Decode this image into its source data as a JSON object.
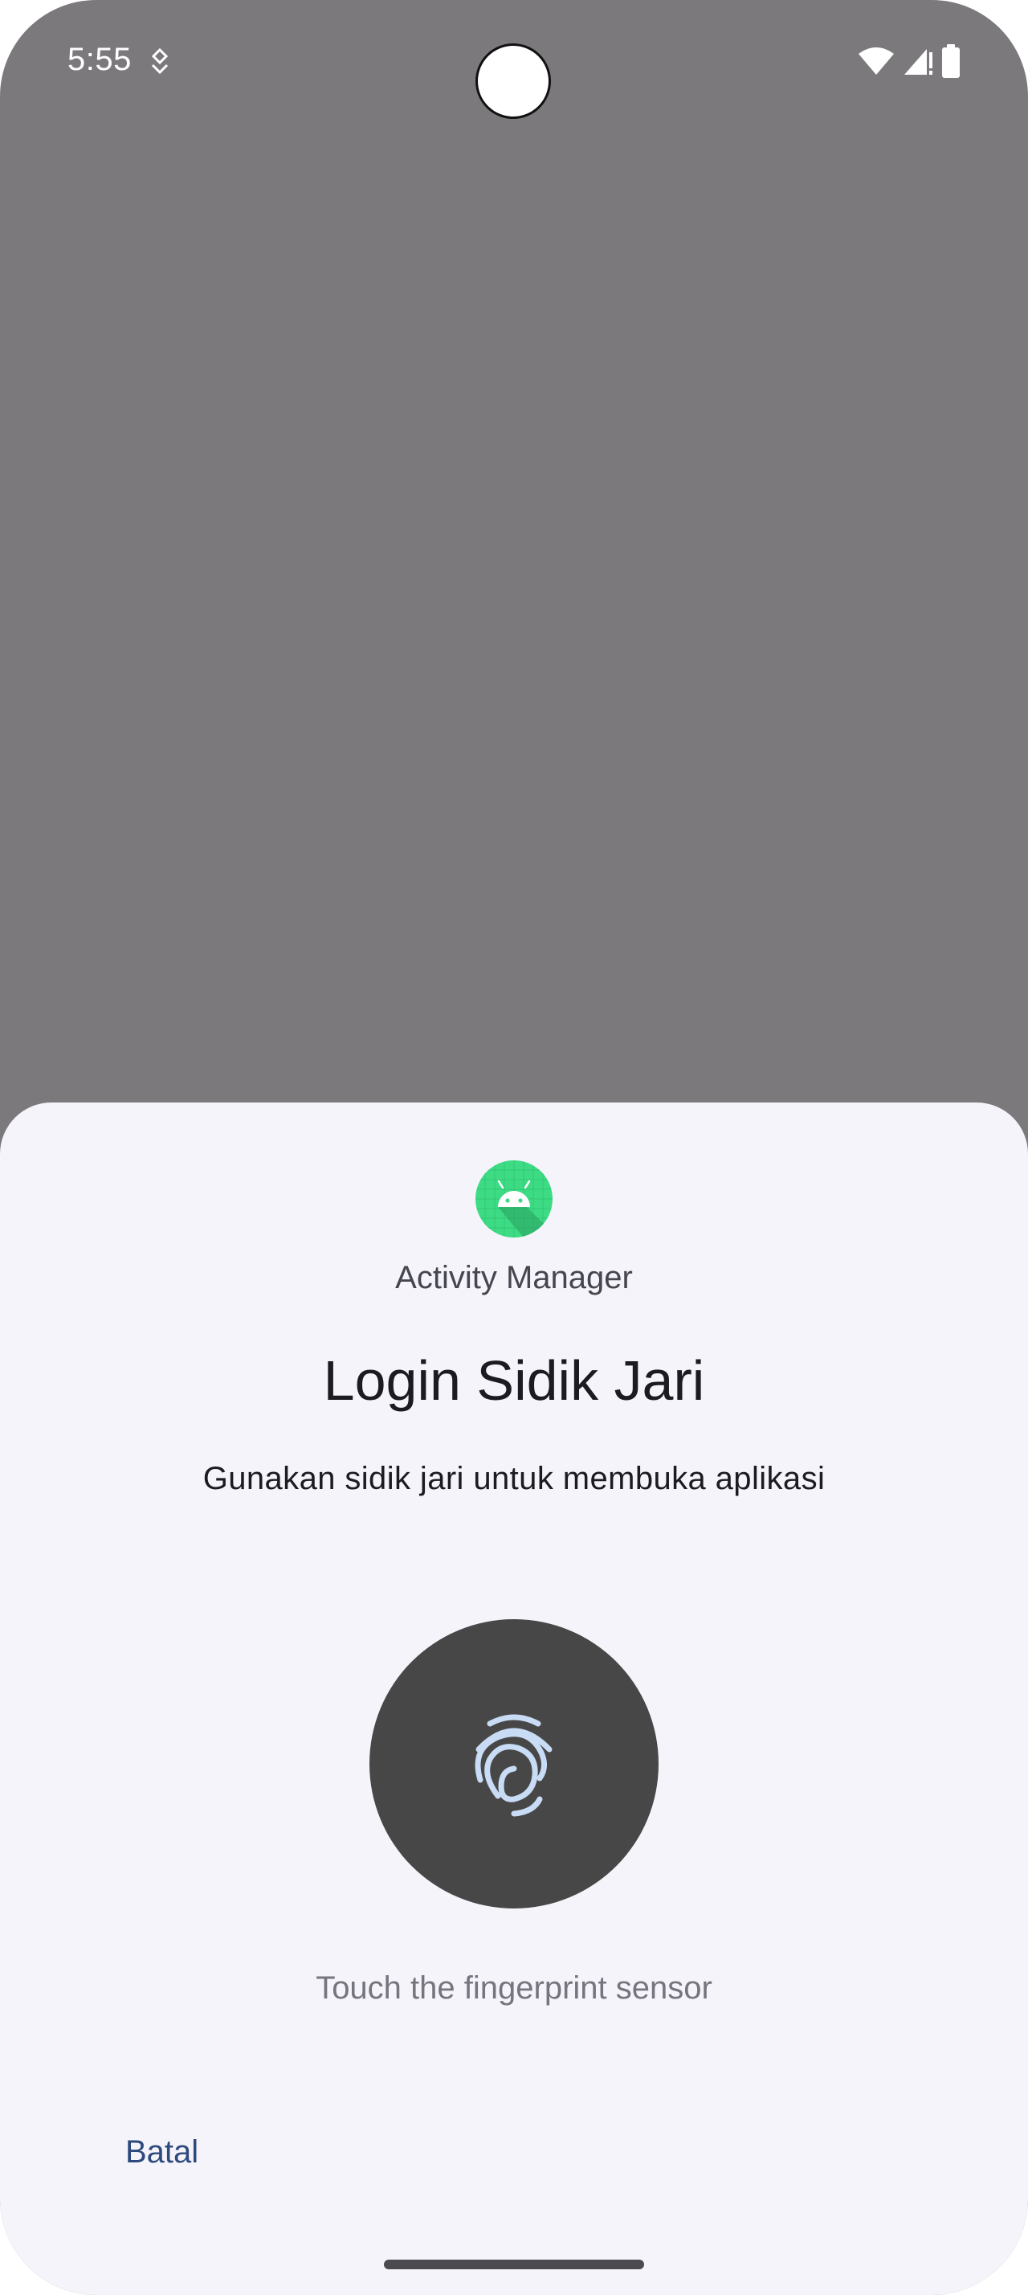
{
  "status_bar": {
    "time": "5:55",
    "icons": [
      "notification-icon",
      "wifi-icon",
      "signal-icon",
      "battery-icon"
    ]
  },
  "dialog": {
    "app_icon": "android-app-icon",
    "app_name": "Activity Manager",
    "title": "Login Sidik Jari",
    "subtitle": "Gunakan sidik jari untuk membuka aplikasi",
    "sensor_icon": "fingerprint-icon",
    "hint": "Touch the fingerprint sensor",
    "cancel_label": "Batal"
  },
  "colors": {
    "scrim": "#7b797c",
    "sheet_background": "#f5f4fb",
    "app_icon_green": "#3ddc84",
    "fingerprint_circle": "#474747",
    "fingerprint_lines": "#c9dcf5",
    "cancel_text": "#2e4a7d"
  }
}
